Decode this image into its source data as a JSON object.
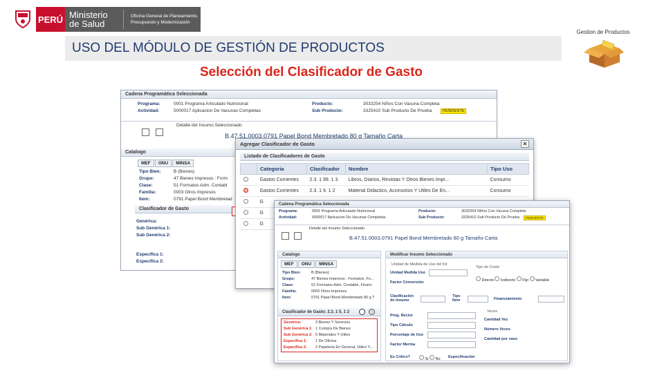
{
  "header": {
    "peru": "PERÚ",
    "ministerio_line1": "Ministerio",
    "ministerio_line2": "de Salud",
    "oficina_line1": "Oficina General de Planeamiento,",
    "oficina_line2": "Presupuesto y Modernización",
    "title": "USO DEL MÓDULO DE GESTIÓN DE PRODUCTOS",
    "subtitle": "Selección del Clasificador de Gasto",
    "gp_label": "Gestion de Productos"
  },
  "win1": {
    "section_title": "Cadena Programática Seleccionada",
    "programa_lbl": "Programa:",
    "programa_val": "0001 Programa Articulado Nutricional",
    "actividad_lbl": "Actividad:",
    "actividad_val": "5000017 Aplicacion De Vacunas Completas",
    "producto_lbl": "Producto:",
    "producto_val": "3033254 Niños Con Vacuna Completa",
    "subproducto_lbl": "Sub Producto:",
    "subproducto_val": "3325410 Sub Producto De Prueba",
    "pendiente": "PENDIENTE",
    "insumo_title": "Detalle del Insumo Seleccionado",
    "insumo_val": "B.47.51.0003.0791 Papel Bond Membretado 80 g Tamaño Carta",
    "catalogo": "Catalogo",
    "tabs": [
      "MEF",
      "ONU",
      "MINSA"
    ],
    "tipo_bien_lbl": "Tipo Bien:",
    "tipo_bien_val": "B (Bienes)",
    "grupo_lbl": "Grupo:",
    "grupo_val": "47 Bienes Impresos : Form",
    "clase_lbl": "Clase:",
    "clase_val": "51 Formatos Adm. Contabl",
    "familia_lbl": "Familia:",
    "familia_val": "0003 Otros Impresos",
    "item_lbl": "Item:",
    "item_val": "0791 Papel Bond Membretad",
    "clasificador_title": "Clasificador de Gasto",
    "generica_lbl": "Genérica:",
    "subgen1_lbl": "Sub Genérica 1:",
    "subgen2_lbl": "Sub Genérica 2:",
    "especifica1_lbl": "Específica 1:",
    "especifica2_lbl": "Específica 2:"
  },
  "win2": {
    "title": "Agregar Clasificador de Gasto",
    "list_title": "Listado de Clasificadores de Gasto",
    "columns": [
      "Categoria",
      "Clasificador",
      "Nombre",
      "Tipo Uso"
    ],
    "rows": [
      {
        "categoria": "Gastos Corrientes",
        "clasificador": "2.3. 1 99. 1 3",
        "nombre": "Libros, Diarios, Revistas Y Otros Bienes Impr...",
        "tipo": "Consumo"
      },
      {
        "categoria": "Gastos Corrientes",
        "clasificador": "2.3. 1 9. 1 2",
        "nombre": "Material Didactico, Accesorios Y Utiles De En...",
        "tipo": "Consumo"
      },
      {
        "categoria": "G",
        "clasificador": "",
        "nombre": "",
        "tipo": ""
      },
      {
        "categoria": "G",
        "clasificador": "",
        "nombre": "",
        "tipo": ""
      },
      {
        "categoria": "G",
        "clasificador": "",
        "nombre": "",
        "tipo": ""
      }
    ]
  },
  "win3": {
    "section_title": "Cadena Programática Seleccionada",
    "programa_lbl": "Programa:",
    "programa_val": "0001 Programa Articulado Nutricional",
    "actividad_lbl": "Actividad:",
    "actividad_val": "5000017 Aplicacion De Vacunas Completas",
    "producto_lbl": "Producto:",
    "producto_val": "3033254 Niños Con Vacuna Completa",
    "subproducto_lbl": "Sub Producto:",
    "subproducto_val": "3325410 Sub Producto De Prueba",
    "pendiente": "PENDIENTE",
    "insumo_title": "Detalle del Insumo Seleccionado",
    "insumo_val": "B.47.51.0003.0791 Papel Bond Membretado 80 g Tamaño Carta",
    "catalogo": "Catalogo",
    "tabs": [
      "MEF",
      "ONU",
      "MINSA"
    ],
    "cat_rows": [
      {
        "lbl": "Tipo Bien:",
        "val": "B (Bienes)"
      },
      {
        "lbl": "Grupo:",
        "val": "47 Bienes Impresos : Formatos, Fo..."
      },
      {
        "lbl": "Clase:",
        "val": "51 Formatos Adm. Contable, Financ"
      },
      {
        "lbl": "Familia:",
        "val": "0003 Otros Impresos"
      },
      {
        "lbl": "Item:",
        "val": "0791 Papel Bond Membretado 80 g T"
      }
    ],
    "clasif_title": "Clasificador de Gasto: 2.3. 1 5. 1 2",
    "clasif_rows": [
      {
        "lbl": "Genérica:",
        "val": "3 Bienes Y Servicios"
      },
      {
        "lbl": "Sub Genérica 1:",
        "val": "1 Compra De Bienes"
      },
      {
        "lbl": "Sub Genérica 2:",
        "val": "5 Materiales Y Utiles"
      },
      {
        "lbl": "Específica 1:",
        "val": "1 De Oficina"
      },
      {
        "lbl": "Específica 2:",
        "val": "2 Papeleria En General, Utiles Y..."
      }
    ],
    "modificar_title": "Modificar Insumo Seleccionado",
    "unidades_title": "Unidad de Medida de Uso del Kit",
    "unidad_uso_lbl": "Unidad Medida Uso",
    "factor_lbl": "Factor Conversión",
    "tipo_costo_title": "Tipo de Costo",
    "tipo_costo_opts": [
      "Directo",
      "Indirecto",
      "Fijo",
      "Variable"
    ],
    "clasif_insumo_lbl": "Clasificación de Insumo",
    "tipo_item_lbl": "Tipo Item",
    "financiamiento_lbl": "Financiamiento",
    "prog_rector_lbl": "Prog. Rector",
    "tipo_calculo_lbl": "Tipo Cálculo",
    "porcentaje_lbl": "Porcentaje de Uso",
    "factor_merma_lbl": "Factor Merma",
    "veces_title": "Veces",
    "cantidad_vez_lbl": "Cantidad Vez",
    "numero_veces_lbl": "Número Veces",
    "cantidad_caso_lbl": "Cantidad por caso",
    "es_critico_lbl": "Es Crítico?",
    "si": "Si",
    "no": "No",
    "especificacion_lbl": "Especificación"
  },
  "colors": {
    "accent_red": "#d9261c",
    "title_blue": "#1f3b6e",
    "pendiente": "#ffe600"
  }
}
